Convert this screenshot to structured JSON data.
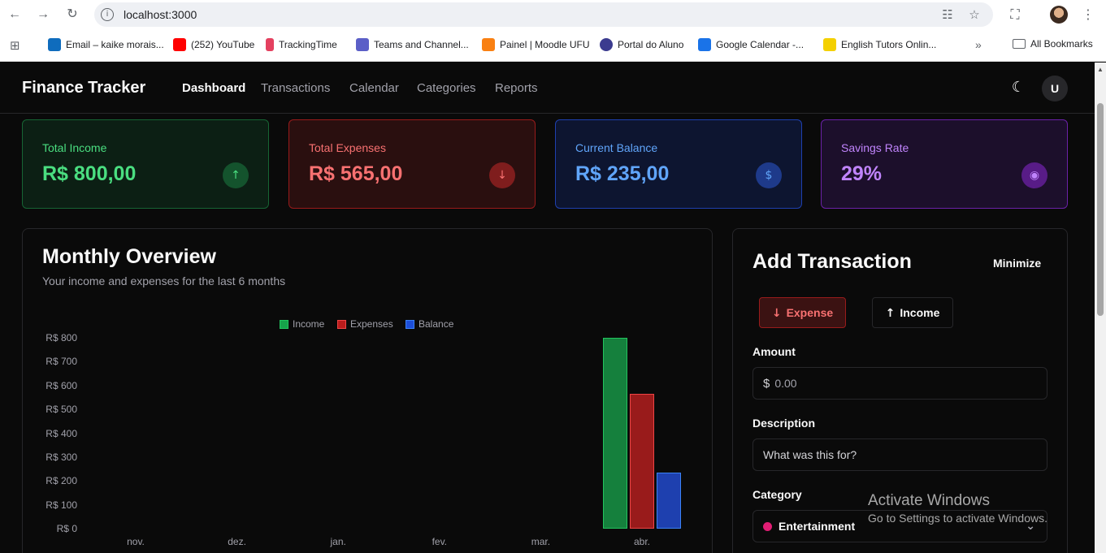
{
  "browser": {
    "url": "localhost:3000",
    "bookmarks": [
      {
        "label": "Email – kaike morais...",
        "color": "#0f6cbd"
      },
      {
        "label": "(252) YouTube",
        "color": "#ff0000"
      },
      {
        "label": "TrackingTime",
        "color": "#e4405f"
      },
      {
        "label": "Teams and Channel...",
        "color": "#5b5fc7"
      },
      {
        "label": "Painel | Moodle UFU",
        "color": "#f98012"
      },
      {
        "label": "Portal do Aluno",
        "color": "#3b3b8f"
      },
      {
        "label": "Google Calendar -...",
        "color": "#1a73e8"
      },
      {
        "label": "English Tutors Onlin...",
        "color": "#f4d000"
      }
    ],
    "all_bookmarks": "All Bookmarks"
  },
  "header": {
    "brand": "Finance Tracker",
    "nav": [
      "Dashboard",
      "Transactions",
      "Calendar",
      "Categories",
      "Reports"
    ],
    "active": "Dashboard",
    "user_initial": "U"
  },
  "cards": [
    {
      "label": "Total Income",
      "value": "R$ 800,00",
      "icon": "arrow-up-icon",
      "color": "#4ade80"
    },
    {
      "label": "Total Expenses",
      "value": "R$ 565,00",
      "icon": "arrow-down-icon",
      "color": "#f87171"
    },
    {
      "label": "Current Balance",
      "value": "R$ 235,00",
      "icon": "dollar-icon",
      "color": "#60a5fa"
    },
    {
      "label": "Savings Rate",
      "value": "29%",
      "icon": "piggy-bank-icon",
      "color": "#c084fc"
    }
  ],
  "overview": {
    "title": "Monthly Overview",
    "subtitle": "Your income and expenses for the last 6 months"
  },
  "chart_data": {
    "type": "bar",
    "categories": [
      "nov.",
      "dez.",
      "jan.",
      "fev.",
      "mar.",
      "abr."
    ],
    "series": [
      {
        "name": "Income",
        "values": [
          0,
          0,
          0,
          0,
          0,
          800
        ],
        "color": "#16a34a"
      },
      {
        "name": "Expenses",
        "values": [
          0,
          0,
          0,
          0,
          0,
          565
        ],
        "color": "#dc2626"
      },
      {
        "name": "Balance",
        "values": [
          0,
          0,
          0,
          0,
          0,
          235
        ],
        "color": "#2563eb"
      }
    ],
    "yticks": [
      "R$ 0",
      "R$ 100",
      "R$ 200",
      "R$ 300",
      "R$ 400",
      "R$ 500",
      "R$ 600",
      "R$ 700",
      "R$ 800"
    ],
    "ylim": [
      0,
      800
    ],
    "legend": "top-center",
    "grid": false
  },
  "add_transaction": {
    "title": "Add Transaction",
    "minimize": "Minimize",
    "expense_label": "Expense",
    "income_label": "Income",
    "amount_label": "Amount",
    "amount_prefix": "$",
    "amount_placeholder": "0.00",
    "description_label": "Description",
    "description_placeholder": "What was this for?",
    "category_label": "Category",
    "category_value": "Entertainment"
  },
  "watermark": {
    "line1": "Activate Windows",
    "line2": "Go to Settings to activate Windows."
  }
}
